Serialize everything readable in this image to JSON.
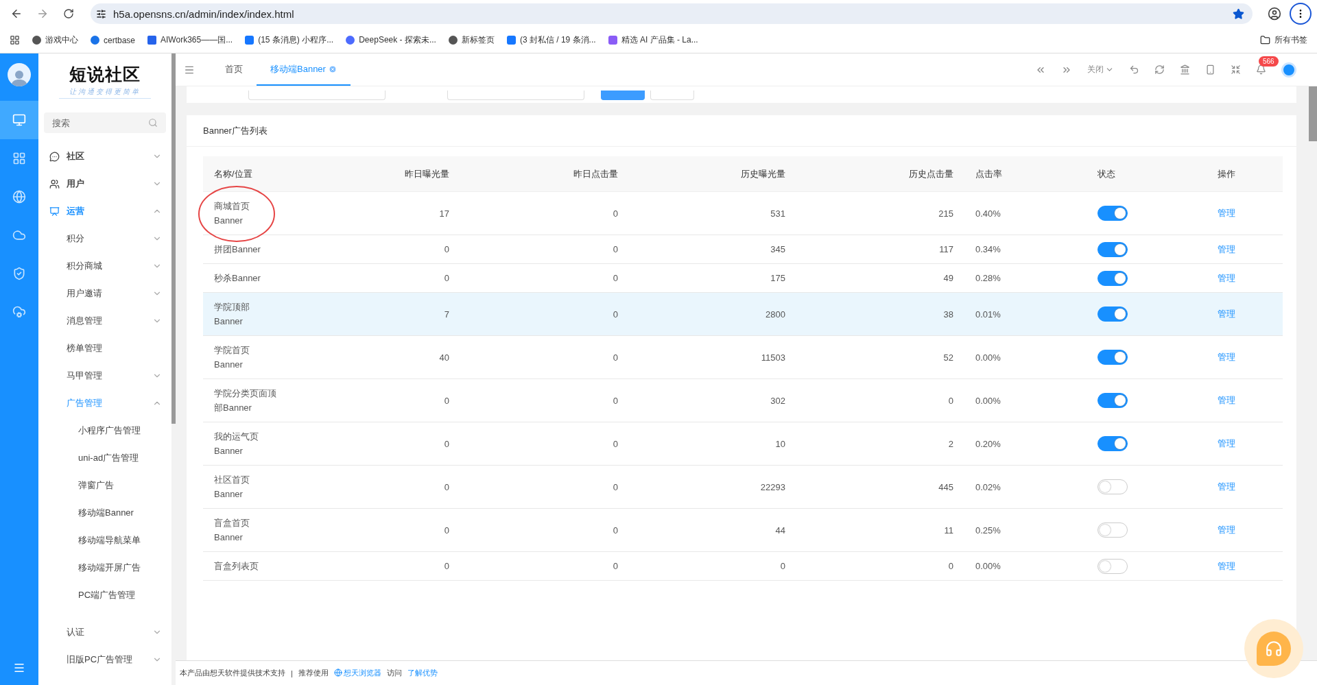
{
  "browser": {
    "url": "h5a.opensns.cn/admin/index/index.html",
    "bookmarked": true,
    "bookmarks": [
      {
        "label": "游戏中心"
      },
      {
        "label": "certbase"
      },
      {
        "label": "AIWork365——国..."
      },
      {
        "label": "(15 条消息) 小程序..."
      },
      {
        "label": "DeepSeek - 探索未..."
      },
      {
        "label": "新标签页"
      },
      {
        "label": "(3 封私信 / 19 条消..."
      },
      {
        "label": "精选 AI 产品集 - La..."
      }
    ],
    "all_bookmarks": "所有书签"
  },
  "brand": {
    "logo": "短说社区",
    "tagline": "让沟通变得更简单"
  },
  "rail": [
    {
      "selected": true
    },
    {
      "selected": false
    },
    {
      "selected": false
    },
    {
      "selected": false
    },
    {
      "selected": false
    },
    {
      "selected": false
    }
  ],
  "sidebar": {
    "search": {
      "placeholder": "搜索"
    },
    "items": [
      {
        "label": "社区",
        "active": false,
        "expanded": false
      },
      {
        "label": "用户",
        "active": false,
        "expanded": false
      },
      {
        "label": "运营",
        "active": true,
        "expanded": true,
        "children": [
          {
            "label": "积分",
            "active": false,
            "expanded": false
          },
          {
            "label": "积分商城",
            "active": false,
            "expanded": false
          },
          {
            "label": "用户邀请",
            "active": false,
            "expanded": false
          },
          {
            "label": "消息管理",
            "active": false,
            "expanded": false
          },
          {
            "label": "榜单管理",
            "active": false
          },
          {
            "label": "马甲管理",
            "active": false,
            "expanded": false
          },
          {
            "label": "广告管理",
            "active": true,
            "expanded": true,
            "children": [
              {
                "label": "小程序广告管理",
                "active": false
              },
              {
                "label": "uni-ad广告管理",
                "active": false
              },
              {
                "label": "弹窗广告",
                "active": false
              },
              {
                "label": "移动端Banner",
                "active": false
              },
              {
                "label": "移动端导航菜单",
                "active": false
              },
              {
                "label": "移动端开屏广告",
                "active": false
              },
              {
                "label": "PC端广告管理",
                "active": false
              }
            ]
          },
          {
            "label": "认证",
            "active": false,
            "expanded": false
          },
          {
            "label": "旧版PC广告管理",
            "active": false,
            "expanded": false
          }
        ]
      }
    ]
  },
  "tabs": [
    {
      "label": "首页",
      "selected": false,
      "closable": false
    },
    {
      "label": "移动端Banner",
      "selected": true,
      "closable": true
    }
  ],
  "toolbar": {
    "close_menu": "关闭",
    "notifications": "566"
  },
  "card": {
    "title": "Banner广告列表"
  },
  "table": {
    "columns": [
      "名称/位置",
      "昨日曝光量",
      "昨日点击量",
      "历史曝光量",
      "历史点击量",
      "点击率",
      "状态",
      "操作"
    ],
    "rows": [
      {
        "name": "商城首页Banner",
        "yesterday_views": "17",
        "yesterday_clicks": "0",
        "total_views": "531",
        "total_clicks": "215",
        "ctr": "0.40%",
        "on": true,
        "action": "管理",
        "selected": false
      },
      {
        "name": "拼团Banner",
        "yesterday_views": "0",
        "yesterday_clicks": "0",
        "total_views": "345",
        "total_clicks": "117",
        "ctr": "0.34%",
        "on": true,
        "action": "管理",
        "selected": false
      },
      {
        "name": "秒杀Banner",
        "yesterday_views": "0",
        "yesterday_clicks": "0",
        "total_views": "175",
        "total_clicks": "49",
        "ctr": "0.28%",
        "on": true,
        "action": "管理",
        "selected": false
      },
      {
        "name": "学院顶部Banner",
        "yesterday_views": "7",
        "yesterday_clicks": "0",
        "total_views": "2800",
        "total_clicks": "38",
        "ctr": "0.01%",
        "on": true,
        "action": "管理",
        "selected": true
      },
      {
        "name": "学院首页Banner",
        "yesterday_views": "40",
        "yesterday_clicks": "0",
        "total_views": "11503",
        "total_clicks": "52",
        "ctr": "0.00%",
        "on": true,
        "action": "管理",
        "selected": false
      },
      {
        "name": "学院分类页面顶部Banner",
        "yesterday_views": "0",
        "yesterday_clicks": "0",
        "total_views": "302",
        "total_clicks": "0",
        "ctr": "0.00%",
        "on": true,
        "action": "管理",
        "selected": false
      },
      {
        "name": "我的运气页Banner",
        "yesterday_views": "0",
        "yesterday_clicks": "0",
        "total_views": "10",
        "total_clicks": "2",
        "ctr": "0.20%",
        "on": true,
        "action": "管理",
        "selected": false
      },
      {
        "name": "社区首页Banner",
        "yesterday_views": "0",
        "yesterday_clicks": "0",
        "total_views": "22293",
        "total_clicks": "445",
        "ctr": "0.02%",
        "on": false,
        "action": "管理",
        "selected": false
      },
      {
        "name": "盲盒首页Banner",
        "yesterday_views": "0",
        "yesterday_clicks": "0",
        "total_views": "44",
        "total_clicks": "11",
        "ctr": "0.25%",
        "on": false,
        "action": "管理",
        "selected": false
      },
      {
        "name": "盲盒列表页",
        "yesterday_views": "0",
        "yesterday_clicks": "0",
        "total_views": "0",
        "total_clicks": "0",
        "ctr": "0.00%",
        "on": false,
        "action": "管理",
        "selected": false
      }
    ]
  },
  "footer": {
    "credit": "本产品由想天软件提供技术支持",
    "separator": "|",
    "recommend": "推荐使用",
    "browser_link": "想天浏览器",
    "visit": "访问",
    "learn_link": "了解优势"
  }
}
